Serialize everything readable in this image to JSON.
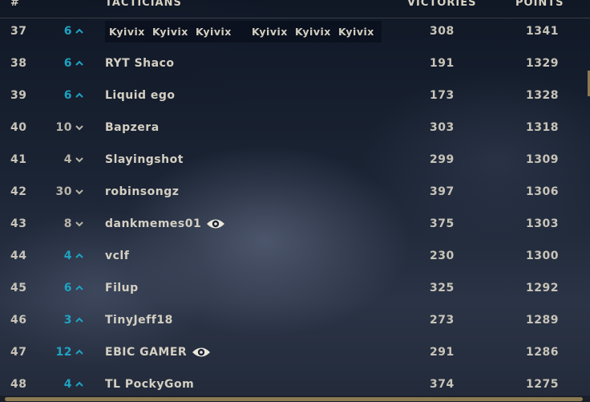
{
  "header": {
    "rank": "#",
    "name": "TACTICIANS",
    "victories": "VICTORIES",
    "points": "POINTS"
  },
  "banner_names": [
    "Kyivix",
    "Kyivix",
    "Kyivix",
    "Kyivix",
    "Kyivix",
    "Kyivix"
  ],
  "rows": [
    {
      "rank": "37",
      "change": "6",
      "dir": "up",
      "name": "",
      "victories": "308",
      "points": "1341"
    },
    {
      "rank": "38",
      "change": "6",
      "dir": "up",
      "name": "RYT Shaco",
      "victories": "191",
      "points": "1329"
    },
    {
      "rank": "39",
      "change": "6",
      "dir": "up",
      "name": "Liquid ego",
      "victories": "173",
      "points": "1328"
    },
    {
      "rank": "40",
      "change": "10",
      "dir": "down",
      "name": "Bapzera",
      "victories": "303",
      "points": "1318"
    },
    {
      "rank": "41",
      "change": "4",
      "dir": "down",
      "name": "Slayingshot",
      "victories": "299",
      "points": "1309"
    },
    {
      "rank": "42",
      "change": "30",
      "dir": "down",
      "name": "robinsongz",
      "victories": "397",
      "points": "1306"
    },
    {
      "rank": "43",
      "change": "8",
      "dir": "down",
      "name": "dankmemes01",
      "victories": "375",
      "points": "1303",
      "eye": true
    },
    {
      "rank": "44",
      "change": "4",
      "dir": "up",
      "name": "vclf",
      "victories": "230",
      "points": "1300"
    },
    {
      "rank": "45",
      "change": "6",
      "dir": "up",
      "name": "Filup",
      "victories": "325",
      "points": "1292"
    },
    {
      "rank": "46",
      "change": "3",
      "dir": "up",
      "name": "TinyJeff18",
      "victories": "273",
      "points": "1289"
    },
    {
      "rank": "47",
      "change": "12",
      "dir": "up",
      "name": "EBIC GAMER",
      "victories": "291",
      "points": "1286",
      "eye": true
    },
    {
      "rank": "48",
      "change": "4",
      "dir": "up",
      "name": "TL PockyGom",
      "victories": "374",
      "points": "1275"
    }
  ]
}
